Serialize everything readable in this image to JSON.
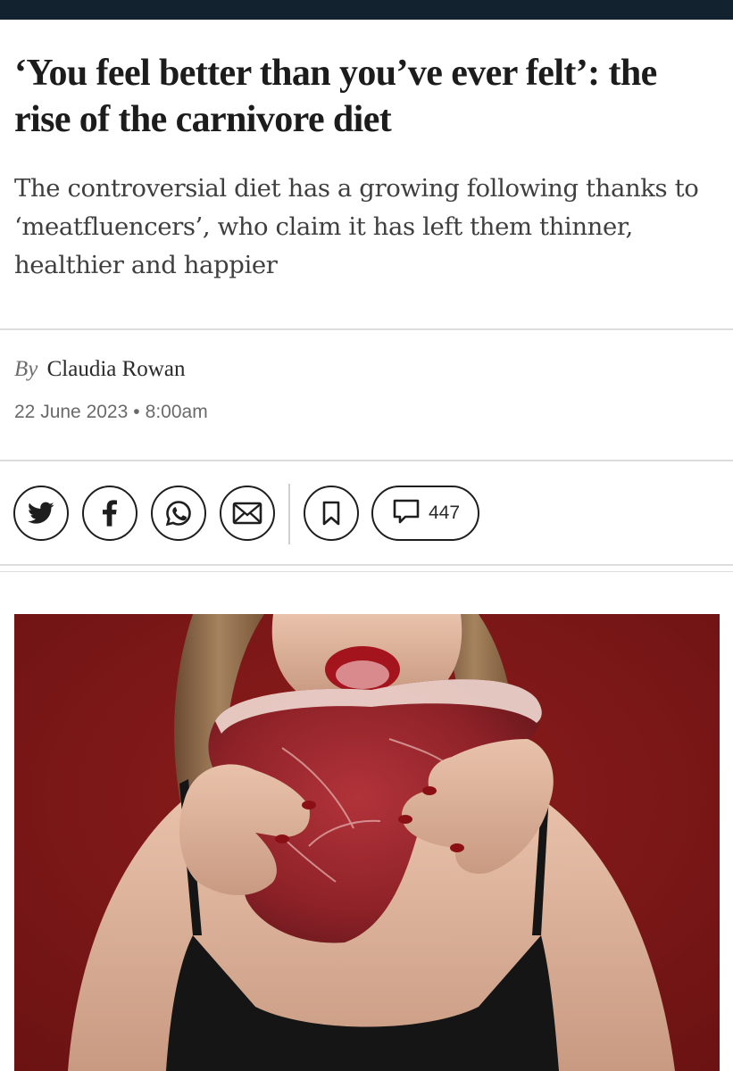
{
  "article": {
    "headline": "‘You feel better than you’ve ever felt’: the rise of the carnivore diet",
    "standfirst": "The controversial diet has a growing following thanks to ‘meatfluencers’, who claim it has left them thinner, healthier and happier",
    "byline_prefix": "By",
    "author": "Claudia Rowan",
    "date": "22 June 2023",
    "date_separator": "•",
    "time": "8:00am"
  },
  "share": {
    "icons": [
      "twitter-icon",
      "facebook-icon",
      "whatsapp-icon",
      "email-icon",
      "bookmark-icon",
      "comment-icon"
    ],
    "comment_count": "447"
  },
  "colors": {
    "top_bar": "#12222f",
    "photo_background": "#7d1717",
    "rule": "#dcdcdc"
  }
}
